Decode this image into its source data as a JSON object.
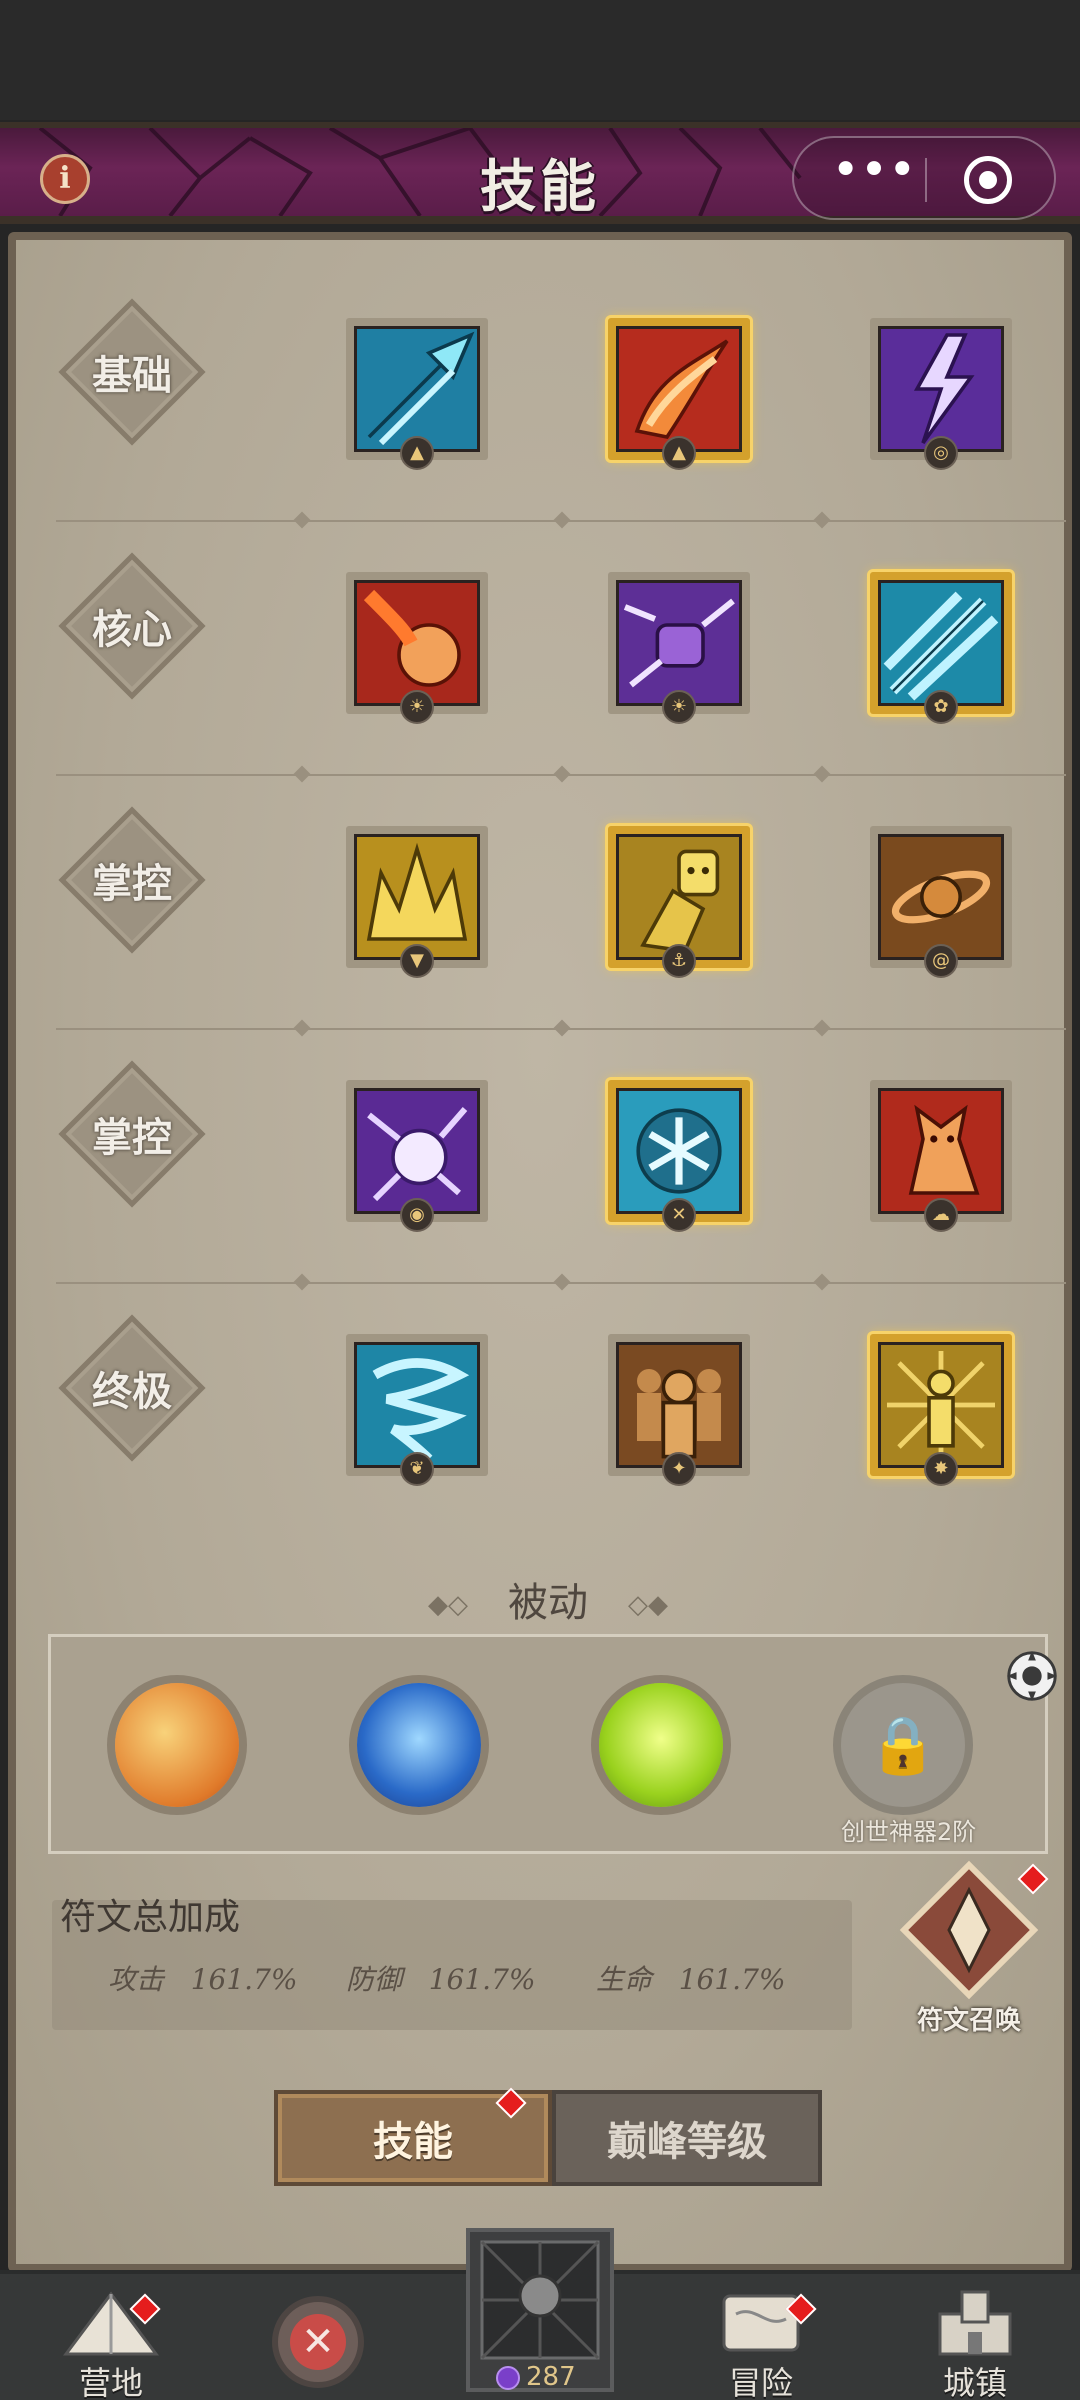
{
  "header": {
    "title": "技能",
    "info_icon": "info-icon",
    "more_icon": "more-dots-icon",
    "target_icon": "record-target-icon"
  },
  "skill_rows": [
    {
      "label": "基础",
      "skills": [
        {
          "icon": "ice-arrow-icon",
          "selected": false,
          "badge": "flame"
        },
        {
          "icon": "fire-strike-icon",
          "selected": true,
          "badge": "flame"
        },
        {
          "icon": "lightning-bolt-icon",
          "selected": false,
          "badge": "swirl"
        }
      ]
    },
    {
      "label": "核心",
      "skills": [
        {
          "icon": "fireball-icon",
          "selected": false,
          "badge": "sun"
        },
        {
          "icon": "storm-fist-icon",
          "selected": false,
          "badge": "sun"
        },
        {
          "icon": "ice-shards-icon",
          "selected": true,
          "badge": "flower"
        }
      ]
    },
    {
      "label": "掌控",
      "skills": [
        {
          "icon": "golden-crown-icon",
          "selected": false,
          "badge": "shield"
        },
        {
          "icon": "golden-avatar-icon",
          "selected": true,
          "badge": "anchor"
        },
        {
          "icon": "sandstorm-icon",
          "selected": false,
          "badge": "spiral"
        }
      ]
    },
    {
      "label": "掌控",
      "skills": [
        {
          "icon": "lightning-orb-icon",
          "selected": false,
          "badge": "eye"
        },
        {
          "icon": "snowflake-icon",
          "selected": true,
          "badge": "cross"
        },
        {
          "icon": "fire-beast-icon",
          "selected": false,
          "badge": "cloud"
        }
      ]
    },
    {
      "label": "终极",
      "skills": [
        {
          "icon": "tornado-icon",
          "selected": false,
          "badge": "leaf"
        },
        {
          "icon": "earth-clones-icon",
          "selected": false,
          "badge": "star"
        },
        {
          "icon": "golden-warrior-icon",
          "selected": true,
          "badge": "star"
        }
      ]
    }
  ],
  "passive": {
    "title": "被动",
    "items": [
      {
        "icon": "golden-clock-icon",
        "locked": false
      },
      {
        "icon": "blue-shield-icon",
        "locked": false
      },
      {
        "icon": "green-heart-icon",
        "locked": false
      },
      {
        "icon": "lock-icon",
        "locked": true
      }
    ],
    "lock_caption": "创世神器2阶"
  },
  "rune": {
    "title": "符文总加成",
    "stats": [
      {
        "label": "攻击",
        "value": "161.7%"
      },
      {
        "label": "防御",
        "value": "161.7%"
      },
      {
        "label": "生命",
        "value": "161.7%"
      }
    ],
    "summon_label": "符文召唤"
  },
  "tabs": {
    "active": "技能",
    "inactive": "巅峰等级"
  },
  "bottom_nav": {
    "camp": "营地",
    "adventure": "冒险",
    "town": "城镇",
    "currency": "287"
  },
  "colors": {
    "accent_gold": "#d4a12c",
    "title_bar": "#6b2456",
    "parchment": "#b2a997",
    "notify_red": "#e51d1d"
  }
}
